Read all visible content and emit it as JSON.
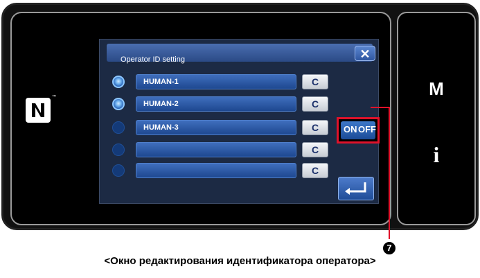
{
  "dialog": {
    "title": "Operator ID setting",
    "close_glyph": "✕"
  },
  "operators": [
    {
      "name": "HUMAN-1",
      "selected": true,
      "clear_label": "C"
    },
    {
      "name": "HUMAN-2",
      "selected": true,
      "clear_label": "C"
    },
    {
      "name": "HUMAN-3",
      "selected": false,
      "clear_label": "C"
    },
    {
      "name": "",
      "selected": false,
      "clear_label": "C"
    },
    {
      "name": "",
      "selected": false,
      "clear_label": "C"
    }
  ],
  "toggle": {
    "on_label": "ON",
    "off_label": "OFF",
    "highlight_color": "#e0122a"
  },
  "side_panel": {
    "menu_label": "M",
    "info_label": "i"
  },
  "callout": {
    "number": "7"
  },
  "caption": "<Окно редактирования идентификатора оператора>",
  "icons": {
    "nfc": "nfc-icon",
    "enter": "enter-icon",
    "close": "close-icon"
  }
}
